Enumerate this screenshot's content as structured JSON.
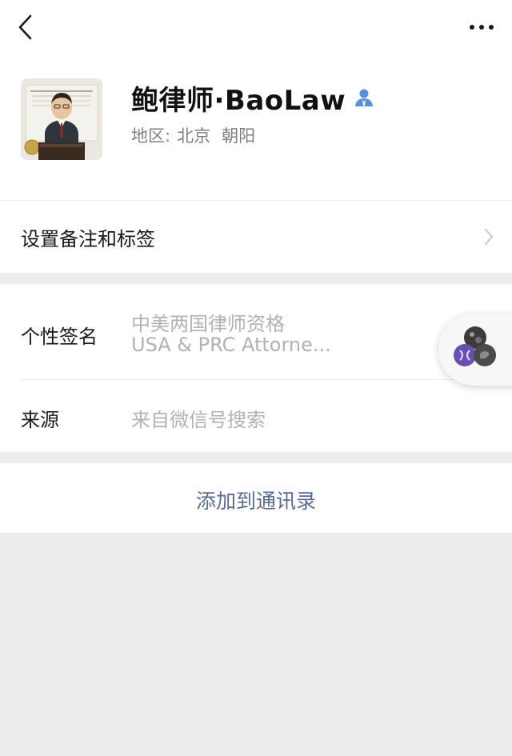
{
  "header": {
    "back_icon": "chevron-left-icon",
    "more_icon": "more-dots-icon"
  },
  "profile": {
    "display_name": "鲍律师·BaoLaw",
    "verified_icon": "user-verified-icon",
    "region_label": "地区:",
    "region_city": "北京",
    "region_district": "朝阳"
  },
  "remark": {
    "label": "设置备注和标签",
    "chevron_icon": "chevron-right-icon"
  },
  "signature": {
    "label": "个性签名",
    "line1": "中美两国律师资格",
    "line2": "USA & PRC Attorne..."
  },
  "source": {
    "label": "来源",
    "value": "来自微信号搜索"
  },
  "add_contact": {
    "label": "添加到通讯录"
  },
  "colors": {
    "link_blue": "#576b95",
    "verified_blue": "#5b8fd6",
    "muted_text": "#b2b2b2",
    "background": "#ededed"
  }
}
